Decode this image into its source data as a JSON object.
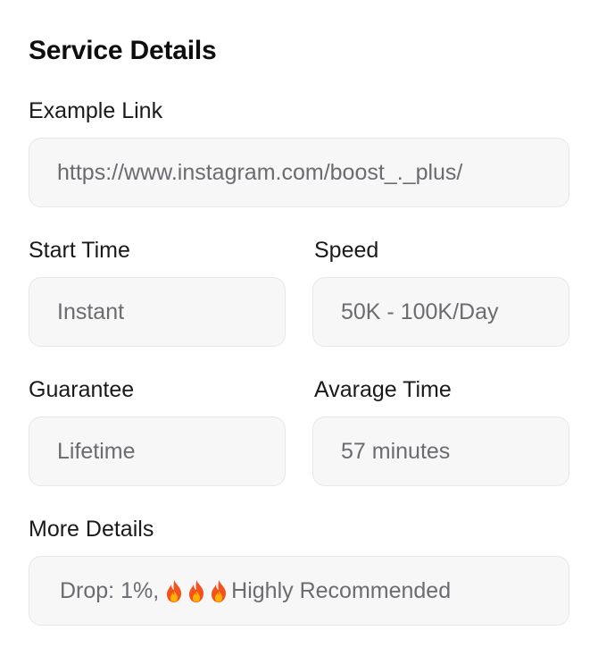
{
  "title": "Service Details",
  "example_link": {
    "label": "Example Link",
    "value": "https://www.instagram.com/boost_._plus/"
  },
  "start_time": {
    "label": "Start Time",
    "value": "Instant"
  },
  "speed": {
    "label": "Speed",
    "value": "50K - 100K/Day"
  },
  "guarantee": {
    "label": "Guarantee",
    "value": "Lifetime"
  },
  "average_time": {
    "label": "Avarage Time",
    "value": "57 minutes"
  },
  "more_details": {
    "label": "More Details",
    "prefix": "Drop: 1%,",
    "icons": [
      "fire-icon",
      "fire-icon",
      "fire-icon"
    ],
    "suffix": "Highly Recommended"
  },
  "colors": {
    "field_bg": "#f7f7f8",
    "field_border": "#e7e7ea",
    "value_text": "#6b6b70",
    "label_text": "#1a1a1a",
    "fire_outer": "#f4511e",
    "fire_inner": "#ffb300"
  }
}
